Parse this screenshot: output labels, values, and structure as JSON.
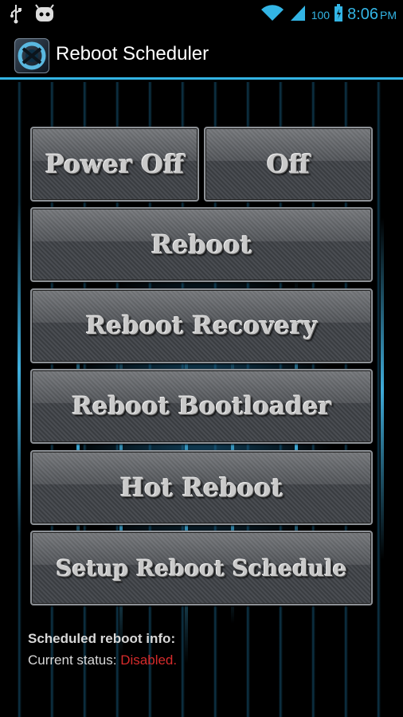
{
  "status_bar": {
    "icons": [
      "usb-icon",
      "android-icon",
      "wifi-icon",
      "signal-icon",
      "battery-icon"
    ],
    "battery_text": "100",
    "time": "8:06",
    "ampm": "PM"
  },
  "action_bar": {
    "title": "Reboot Scheduler",
    "icon": "app-logo-icon"
  },
  "buttons": {
    "power_off": "Power Off",
    "off": "Off",
    "reboot": "Reboot",
    "reboot_recovery": "Reboot Recovery",
    "reboot_bootloader": "Reboot Bootloader",
    "hot_reboot": "Hot Reboot",
    "setup_schedule": "Setup Reboot Schedule"
  },
  "info": {
    "title": "Scheduled reboot info:",
    "status_label": "Current status:",
    "status_value": "Disabled."
  },
  "colors": {
    "accent": "#33b5e5",
    "status_disabled": "#d62b2b",
    "background": "#000000"
  }
}
